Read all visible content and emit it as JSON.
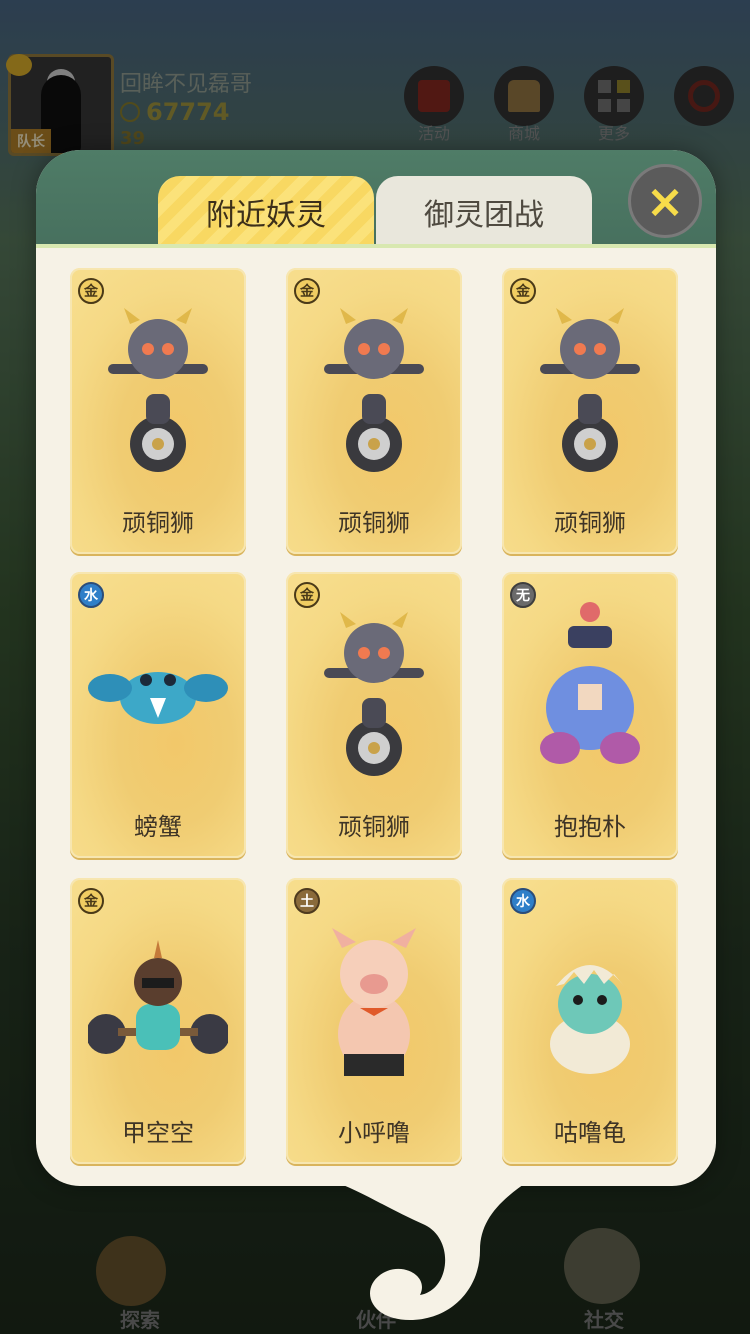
{
  "background": {
    "player": {
      "name": "回眸不见磊哥",
      "coins": "67774",
      "level": "39",
      "captain_tag": "队长"
    },
    "top_buttons": [
      "活动",
      "商城",
      "更多"
    ],
    "bottom_nav": [
      "探索",
      "伙伴",
      "社交"
    ]
  },
  "modal": {
    "tabs": {
      "active": "附近妖灵",
      "inactive": "御灵团战"
    },
    "close_icon": "×",
    "cards": [
      {
        "element": "金",
        "element_type": "metal",
        "name": "顽铜狮"
      },
      {
        "element": "金",
        "element_type": "metal",
        "name": "顽铜狮"
      },
      {
        "element": "金",
        "element_type": "metal",
        "name": "顽铜狮"
      },
      {
        "element": "水",
        "element_type": "water",
        "name": "螃蟹"
      },
      {
        "element": "金",
        "element_type": "metal",
        "name": "顽铜狮"
      },
      {
        "element": "无",
        "element_type": "none",
        "name": "抱抱朴"
      },
      {
        "element": "金",
        "element_type": "metal",
        "name": "甲空空"
      },
      {
        "element": "土",
        "element_type": "earth",
        "name": "小呼噜"
      },
      {
        "element": "水",
        "element_type": "water",
        "name": "咕噜龟"
      }
    ]
  },
  "colors": {
    "card_gold": "#f2c86a",
    "tab_active": "#fbe27a",
    "header_green": "#4f7c67",
    "close_yellow": "#f7dc4a"
  }
}
